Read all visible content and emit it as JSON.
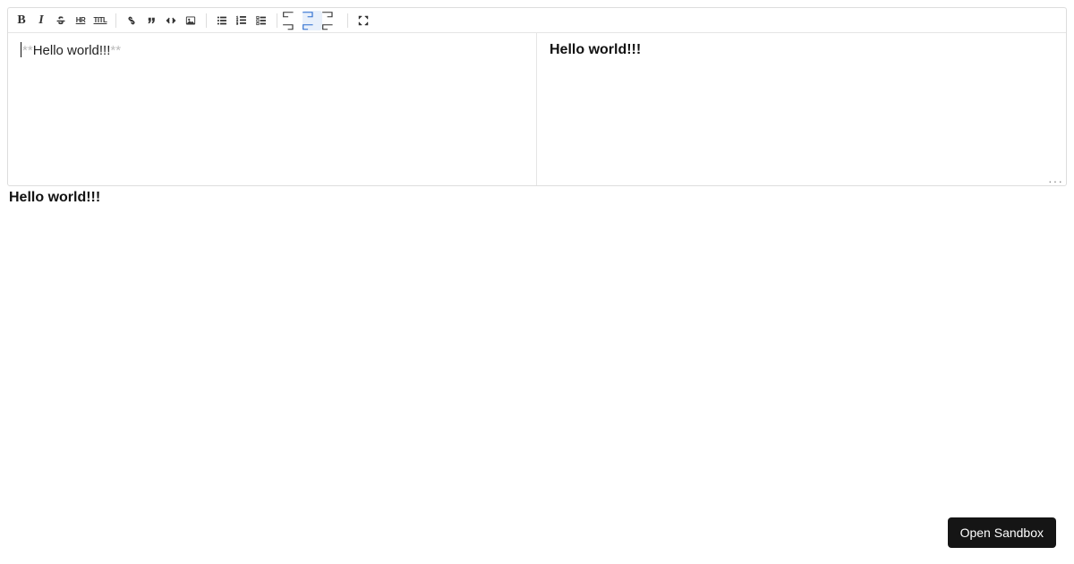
{
  "toolbar": {
    "bold_label": "B",
    "italic_label": "I",
    "hr_label": "HR",
    "title_label": "TITL"
  },
  "editor": {
    "prefix_marks": "**",
    "text": "Hello world!!!",
    "suffix_marks": "**"
  },
  "preview": {
    "text": "Hello world!!!"
  },
  "output": {
    "text": "Hello world!!!"
  },
  "resize_handle": "···",
  "sandbox_button": "Open Sandbox"
}
